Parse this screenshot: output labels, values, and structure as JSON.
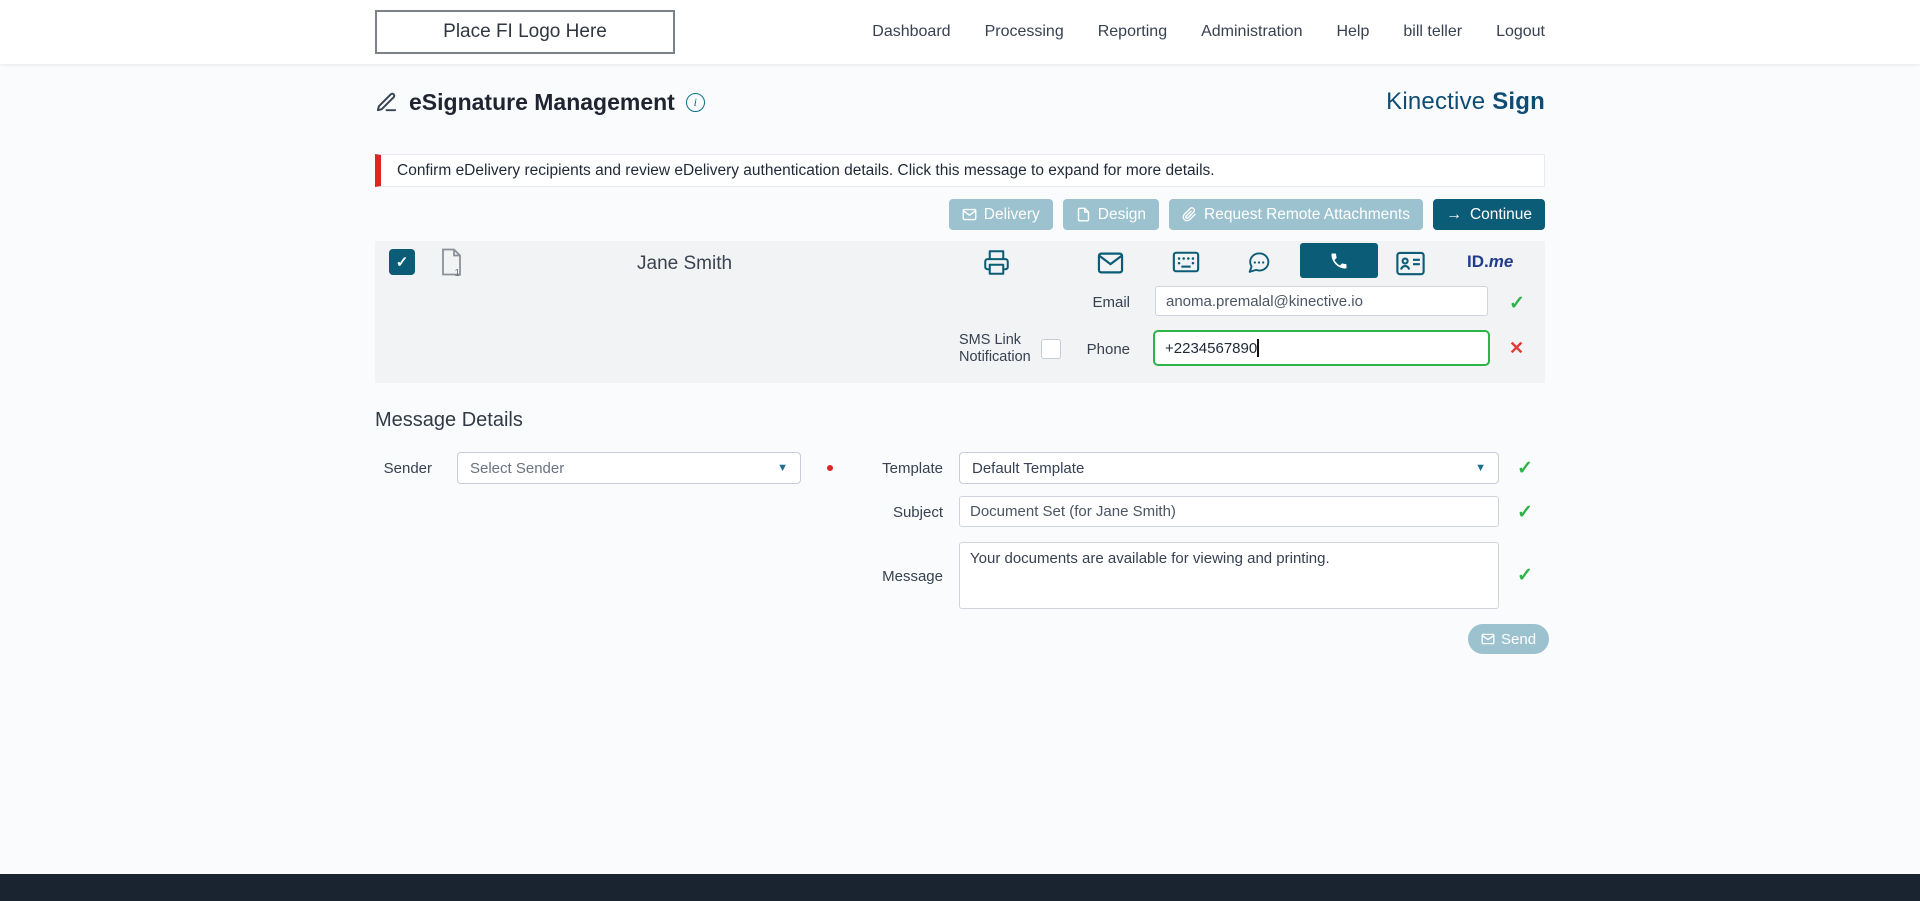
{
  "glyphs": {
    "check": "✓",
    "cross": "✕",
    "caret": "▼",
    "arrow_right": "→",
    "info": "i"
  },
  "header": {
    "logo_placeholder": "Place FI Logo Here",
    "nav": [
      {
        "label": "Dashboard"
      },
      {
        "label": "Processing"
      },
      {
        "label": "Reporting"
      },
      {
        "label": "Administration"
      },
      {
        "label": "Help"
      },
      {
        "label": "bill teller"
      },
      {
        "label": "Logout"
      }
    ]
  },
  "page": {
    "title": "eSignature Management",
    "brand_name": "Kinective",
    "brand_product": "Sign",
    "alert_message": "Confirm eDelivery recipients and review eDelivery authentication details. Click this message to expand for more details."
  },
  "toolbar": {
    "delivery_label": "Delivery",
    "design_label": "Design",
    "request_remote_attachments_label": "Request Remote Attachments",
    "continue_label": "Continue"
  },
  "recipient": {
    "name": "Jane Smith",
    "document_count": "1",
    "email_label": "Email",
    "email_value": "anoma.premalal@kinective.io",
    "sms_link_label": "SMS Link Notification",
    "phone_label": "Phone",
    "phone_value": "+2234567890",
    "idme_id": "ID.",
    "idme_me": "me"
  },
  "message_details": {
    "heading": "Message Details",
    "sender_label": "Sender",
    "sender_value": "Select Sender",
    "template_label": "Template",
    "template_value": "Default Template",
    "subject_label": "Subject",
    "subject_value": "Document Set (for Jane Smith)",
    "message_label": "Message",
    "message_value": "Your documents are available for viewing and printing.",
    "send_label": "Send"
  },
  "colors": {
    "primary": "#0b5c77",
    "secondary_button": "#9cc2cf",
    "success": "#2eb348",
    "danger": "#e23b3b",
    "alert_accent": "#dc2626",
    "brand_text": "#0f4c75",
    "footer": "#1a2430"
  }
}
